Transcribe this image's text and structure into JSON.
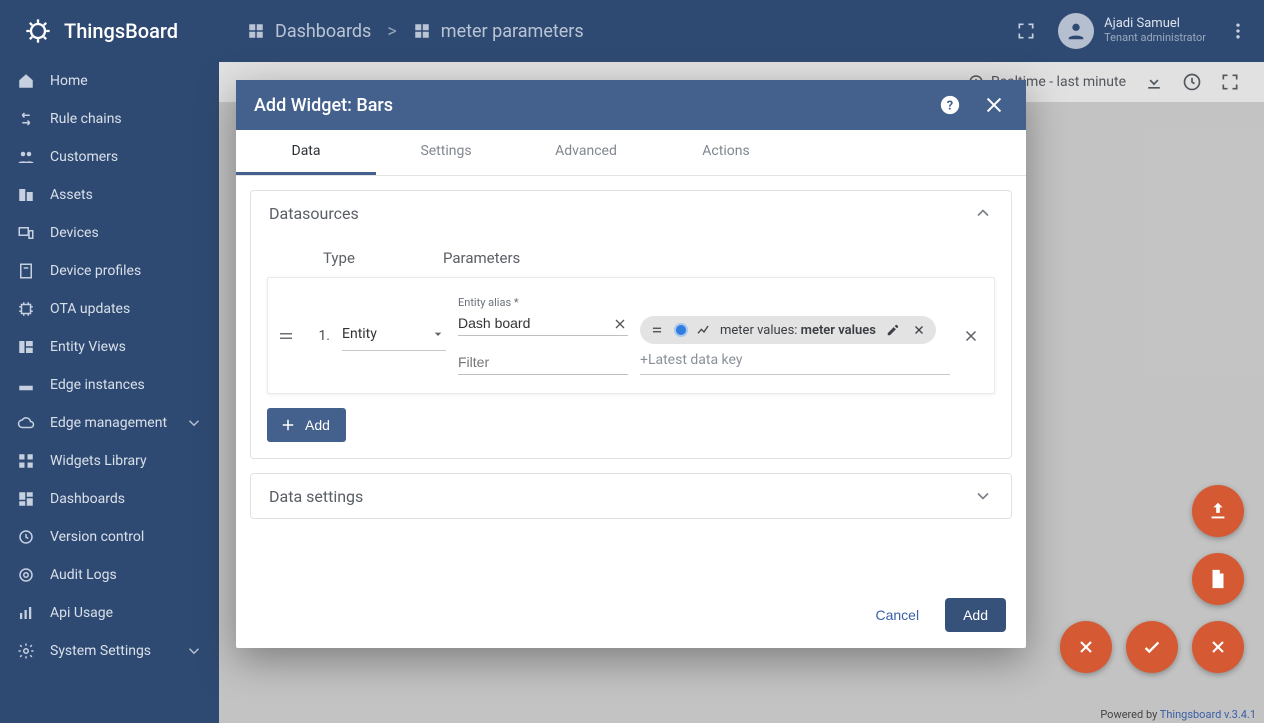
{
  "brand": {
    "name": "ThingsBoard"
  },
  "breadcrumbs": {
    "root": "Dashboards",
    "sep": ">",
    "current": "meter parameters"
  },
  "user": {
    "name": "Ajadi Samuel",
    "role": "Tenant administrator"
  },
  "toolbar": {
    "realtime_label": "Realtime - last minute"
  },
  "sidebar": {
    "items": [
      {
        "label": "Home"
      },
      {
        "label": "Rule chains"
      },
      {
        "label": "Customers"
      },
      {
        "label": "Assets"
      },
      {
        "label": "Devices"
      },
      {
        "label": "Device profiles"
      },
      {
        "label": "OTA updates"
      },
      {
        "label": "Entity Views"
      },
      {
        "label": "Edge instances"
      },
      {
        "label": "Edge management",
        "expandable": true
      },
      {
        "label": "Widgets Library"
      },
      {
        "label": "Dashboards"
      },
      {
        "label": "Version control"
      },
      {
        "label": "Audit Logs"
      },
      {
        "label": "Api Usage"
      },
      {
        "label": "System Settings",
        "expandable": true
      }
    ]
  },
  "dialog": {
    "title": "Add Widget: Bars",
    "tabs": {
      "data": "Data",
      "settings": "Settings",
      "advanced": "Advanced",
      "actions": "Actions"
    },
    "datasources": {
      "header": "Datasources",
      "col_type": "Type",
      "col_params": "Parameters",
      "row1": {
        "index": "1.",
        "type_value": "Entity",
        "alias_label": "Entity alias *",
        "alias_value": "Dash board",
        "filter_label": "Filter",
        "filter_value": "",
        "chip_prefix": "meter values: ",
        "chip_bold": "meter values",
        "add_key_placeholder": "+Latest data key"
      },
      "add_label": "Add"
    },
    "data_settings": {
      "header": "Data settings"
    },
    "footer": {
      "cancel": "Cancel",
      "add": "Add"
    }
  },
  "footer": {
    "powered": "Powered by ",
    "link": "Thingsboard v.3.4.1"
  },
  "colors": {
    "accent": "#44618d",
    "fab": "#d55a33",
    "chip_swatch": "#2f7de1"
  }
}
